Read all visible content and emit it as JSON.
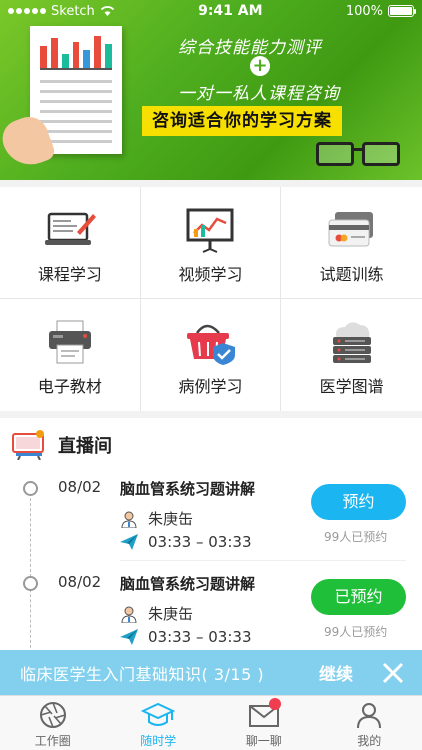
{
  "status_bar": {
    "carrier": "Sketch",
    "time": "9:41 AM",
    "battery": "100%",
    "battery_level": 1.0
  },
  "banner": {
    "line1": "综合技能能力测评",
    "plus": "+",
    "line2": "一对一私人课程咨询",
    "cta": "咨询适合你的学习方案"
  },
  "menu": [
    {
      "label": "课程学习",
      "icon": "laptop-pen-icon"
    },
    {
      "label": "视频学习",
      "icon": "presentation-board-icon"
    },
    {
      "label": "试题训练",
      "icon": "id-card-icon"
    },
    {
      "label": "电子教材",
      "icon": "printer-icon"
    },
    {
      "label": "病例学习",
      "icon": "basket-shield-icon"
    },
    {
      "label": "医学图谱",
      "icon": "cloud-server-icon"
    }
  ],
  "live": {
    "title": "直播间",
    "items": [
      {
        "date": "08/02",
        "title": "脑血管系统习题讲解",
        "teacher": "朱庚缶",
        "time": "03:33 – 03:33",
        "button": "预约",
        "button_color": "#1bb6f2",
        "count": "99人已预约"
      },
      {
        "date": "08/02",
        "title": "脑血管系统习题讲解",
        "teacher": "朱庚缶",
        "time": "03:33 – 03:33",
        "button": "已预约",
        "button_color": "#1fbf3a",
        "count": "99人已预约"
      }
    ]
  },
  "continue_bar": {
    "text": "临床医学生入门基础知识( 3/15 )",
    "button": "继续"
  },
  "tabs": [
    {
      "label": "工作圈",
      "icon": "aperture-icon",
      "active": false
    },
    {
      "label": "随时学",
      "icon": "graduation-cap-icon",
      "active": true
    },
    {
      "label": "聊一聊",
      "icon": "mail-icon",
      "active": false,
      "badge": true
    },
    {
      "label": "我的",
      "icon": "person-icon",
      "active": false
    }
  ],
  "colors": {
    "accent": "#1bb6f2",
    "green": "#1fbf3a",
    "banner_green": "#4fae1f",
    "cta_yellow": "#f7e000",
    "badge_red": "#f23c50"
  }
}
